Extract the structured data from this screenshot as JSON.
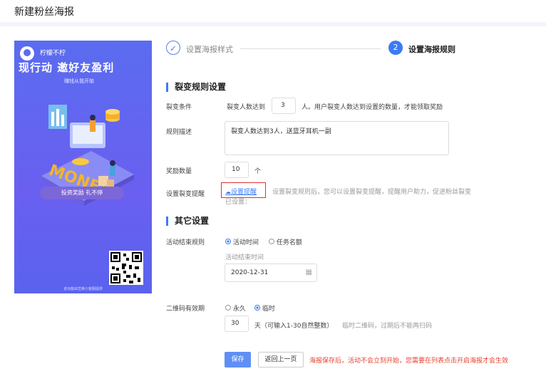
{
  "page": {
    "title": "新建粉丝海报"
  },
  "poster": {
    "brand": "柠檬不柠",
    "headline": "现行动 邀好友盈利",
    "subline": "赚钱从我开始",
    "pill": "投资奖励 礼不停",
    "footer": "该功能由芝麻小客服提供"
  },
  "steps": [
    {
      "num": "✓",
      "label": "设置海报样式"
    },
    {
      "num": "2",
      "label": "设置海报规则"
    }
  ],
  "fission": {
    "section_title": "裂变规则设置",
    "condition_label": "裂变条件",
    "condition_prefix": "裂变人数达到",
    "condition_value": "3",
    "condition_suffix": "人。用户裂变人数达到设置的数量，才能领取奖励",
    "desc_label": "规则描述",
    "desc_value": "裂变人数达到3人，送蓝牙耳机一副",
    "reward_label": "奖励数量",
    "reward_value": "10",
    "reward_unit": "个",
    "reminder_label": "设置裂变提醒",
    "reminder_link": "设置提醒",
    "reminder_hint_1": "设置裂变规则后，您可以设置裂变提醒，提醒用户助力，促进粉丝裂变",
    "reminder_hint_2": "已设置："
  },
  "other": {
    "section_title": "其它设置",
    "end_rule_label": "活动结束规则",
    "end_rule_options": [
      "活动时间",
      "任务名额"
    ],
    "end_time_label": "活动结束时间",
    "end_time_value": "2020-12-31",
    "qr_label": "二维码有效期",
    "qr_options": [
      "永久",
      "临时"
    ],
    "qr_days_value": "30",
    "qr_days_unit": "天（可输入1-30自然整数）",
    "qr_days_hint": "临时二维码，过期后不能再扫码"
  },
  "actions": {
    "save": "保存",
    "back": "返回上一页",
    "warning": "海报保存后，活动不会立刻开始，您需要在列表点击开启海报才会生效"
  },
  "colors": {
    "primary": "#3a7bf5",
    "warning": "#e8402f",
    "poster_bg": "#5a6cf0"
  }
}
